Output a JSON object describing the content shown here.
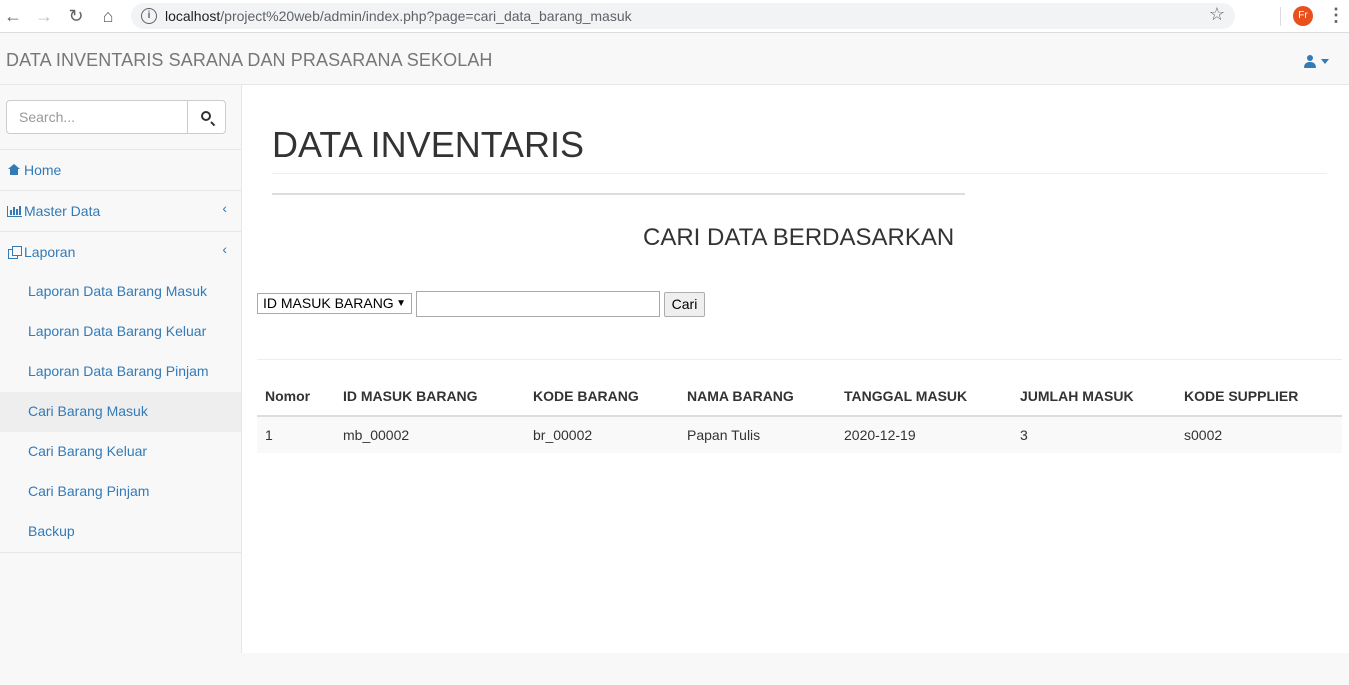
{
  "browser": {
    "url_host": "localhost",
    "url_path": "/project%20web/admin/index.php?page=cari_data_barang_masuk",
    "profile_initials": "Fr"
  },
  "navbar": {
    "brand": "DATA INVENTARIS SARANA DAN PRASARANA SEKOLAH"
  },
  "sidebar": {
    "search_placeholder": "Search...",
    "items": [
      {
        "label": "Home",
        "icon": "home-icon"
      },
      {
        "label": "Master Data",
        "icon": "bar-chart-icon"
      },
      {
        "label": "Laporan",
        "icon": "report-icon"
      }
    ],
    "sub_items": [
      {
        "label": "Laporan Data Barang Masuk"
      },
      {
        "label": "Laporan Data Barang Keluar"
      },
      {
        "label": "Laporan Data Barang Pinjam"
      },
      {
        "label": "Cari Barang Masuk",
        "active": true
      },
      {
        "label": "Cari Barang Keluar"
      },
      {
        "label": "Cari Barang Pinjam"
      },
      {
        "label": "Backup"
      }
    ]
  },
  "main": {
    "page_title": "DATA INVENTARIS",
    "subtitle": "CARI DATA BERDASARKAN",
    "filter": {
      "selected_option": "ID MASUK BARANG",
      "input_value": "",
      "button_label": "Cari"
    },
    "table": {
      "headers": [
        "Nomor",
        "ID MASUK BARANG",
        "KODE BARANG",
        "NAMA BARANG",
        "TANGGAL MASUK",
        "JUMLAH MASUK",
        "KODE SUPPLIER"
      ],
      "rows": [
        [
          "1",
          "mb_00002",
          "br_00002",
          "Papan Tulis",
          "2020-12-19",
          "3",
          "s0002"
        ]
      ]
    }
  },
  "colors": {
    "link": "#337ab7",
    "navbar_bg": "#f8f8f8",
    "profile_avatar": "#e8501e"
  }
}
